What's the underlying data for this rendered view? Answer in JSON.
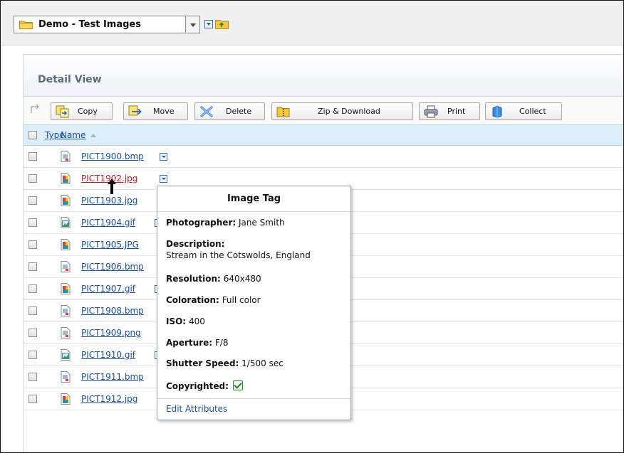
{
  "folder": {
    "name": "Demo - Test Images"
  },
  "panel": {
    "title": "Detail View"
  },
  "toolbar": {
    "copy": "Copy",
    "move": "Move",
    "delete": "Delete",
    "zip": "Zip & Download",
    "print": "Print",
    "collect": "Collect"
  },
  "table": {
    "col_type": "Type",
    "col_name": "Name",
    "rows": [
      {
        "name": "PICT1900.bmp",
        "type": "bmp"
      },
      {
        "name": "PICT1902.jpg",
        "type": "jpg"
      },
      {
        "name": "PICT1903.jpg",
        "type": "jpg"
      },
      {
        "name": "PICT1904.gif",
        "type": "gif"
      },
      {
        "name": "PICT1905.JPG",
        "type": "jpg"
      },
      {
        "name": "PICT1906.bmp",
        "type": "bmp"
      },
      {
        "name": "PICT1907.gif",
        "type": "jpg"
      },
      {
        "name": "PICT1908.bmp",
        "type": "bmp"
      },
      {
        "name": "PICT1909.png",
        "type": "bmp"
      },
      {
        "name": "PICT1910.gif",
        "type": "gif"
      },
      {
        "name": "PICT1911.bmp",
        "type": "bmp"
      },
      {
        "name": "PICT1912.jpg",
        "type": "jpg"
      }
    ]
  },
  "popup": {
    "title": "Image Tag",
    "photographer_label": "Photographer:",
    "photographer": "Jane Smith",
    "description_label": "Description:",
    "description": "Stream in the Cotswolds, England",
    "resolution_label": "Resolution:",
    "resolution": "640x480",
    "coloration_label": "Coloration:",
    "coloration": "Full color",
    "iso_label": "ISO:",
    "iso": "400",
    "aperture_label": "Aperture:",
    "aperture": "F/8",
    "shutter_label": "Shutter Speed:",
    "shutter": "1/500 sec",
    "copyrighted_label": "Copyrighted:",
    "copyrighted": true,
    "edit_link": "Edit Attributes"
  },
  "colors": {
    "link": "#1a4f9c",
    "active_link": "#b0202a",
    "header_bg": "#dceefa",
    "folder": "#f2c744"
  }
}
